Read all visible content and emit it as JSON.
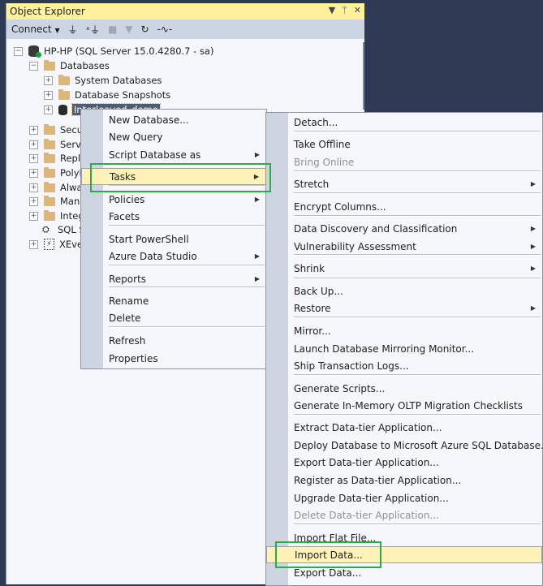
{
  "panel": {
    "title": "Object Explorer",
    "controls": {
      "dropdown": "▾",
      "pin": "📌",
      "close": "✕"
    }
  },
  "toolbar": {
    "connect_label": "Connect",
    "icons": [
      "connect-icon",
      "disconnect-icon",
      "stop-icon",
      "filter-icon",
      "refresh-icon",
      "activity-monitor-icon"
    ]
  },
  "tree": {
    "server": "HP-HP (SQL Server 15.0.4280.7 - sa)",
    "databases": "Databases",
    "system_databases": "System Databases",
    "database_snapshots": "Database Snapshots",
    "selected_db": "Interleaved_demo",
    "truncated": [
      "Secur",
      "Server",
      "Replic",
      "PolyB",
      "Alway",
      "Mana",
      "Integr",
      "SQL S",
      "XEver"
    ]
  },
  "context_menu": {
    "items": [
      {
        "label": "New Database...",
        "submenu": false
      },
      {
        "label": "New Query",
        "submenu": false
      },
      {
        "label": "Script Database as",
        "submenu": true
      },
      {
        "label": "Tasks",
        "submenu": true,
        "highlighted": true
      },
      {
        "label": "Policies",
        "submenu": true
      },
      {
        "label": "Facets",
        "submenu": false
      },
      {
        "label": "Start PowerShell",
        "submenu": false
      },
      {
        "label": "Azure Data Studio",
        "submenu": true
      },
      {
        "label": "Reports",
        "submenu": true
      },
      {
        "label": "Rename",
        "submenu": false
      },
      {
        "label": "Delete",
        "submenu": false
      },
      {
        "label": "Refresh",
        "submenu": false
      },
      {
        "label": "Properties",
        "submenu": false
      }
    ]
  },
  "tasks_submenu": {
    "items": [
      {
        "label": "Detach..."
      },
      {
        "label": "Take Offline"
      },
      {
        "label": "Bring Online",
        "disabled": true
      },
      {
        "label": "Stretch",
        "submenu": true
      },
      {
        "label": "Encrypt Columns..."
      },
      {
        "label": "Data Discovery and Classification",
        "submenu": true
      },
      {
        "label": "Vulnerability Assessment",
        "submenu": true
      },
      {
        "label": "Shrink",
        "submenu": true
      },
      {
        "label": "Back Up..."
      },
      {
        "label": "Restore",
        "submenu": true
      },
      {
        "label": "Mirror..."
      },
      {
        "label": "Launch Database Mirroring Monitor..."
      },
      {
        "label": "Ship Transaction Logs..."
      },
      {
        "label": "Generate Scripts..."
      },
      {
        "label": "Generate In-Memory OLTP Migration Checklists"
      },
      {
        "label": "Extract Data-tier Application..."
      },
      {
        "label": "Deploy Database to Microsoft Azure SQL Database..."
      },
      {
        "label": "Export Data-tier Application..."
      },
      {
        "label": "Register as Data-tier Application..."
      },
      {
        "label": "Upgrade Data-tier Application..."
      },
      {
        "label": "Delete Data-tier Application...",
        "disabled": true
      },
      {
        "label": "Import Flat File..."
      },
      {
        "label": "Import Data...",
        "highlighted": true
      },
      {
        "label": "Export Data..."
      }
    ]
  },
  "colors": {
    "highlight": "#fff2b8",
    "annotation_box": "#2dac45",
    "title_bar": "#fff29d"
  }
}
